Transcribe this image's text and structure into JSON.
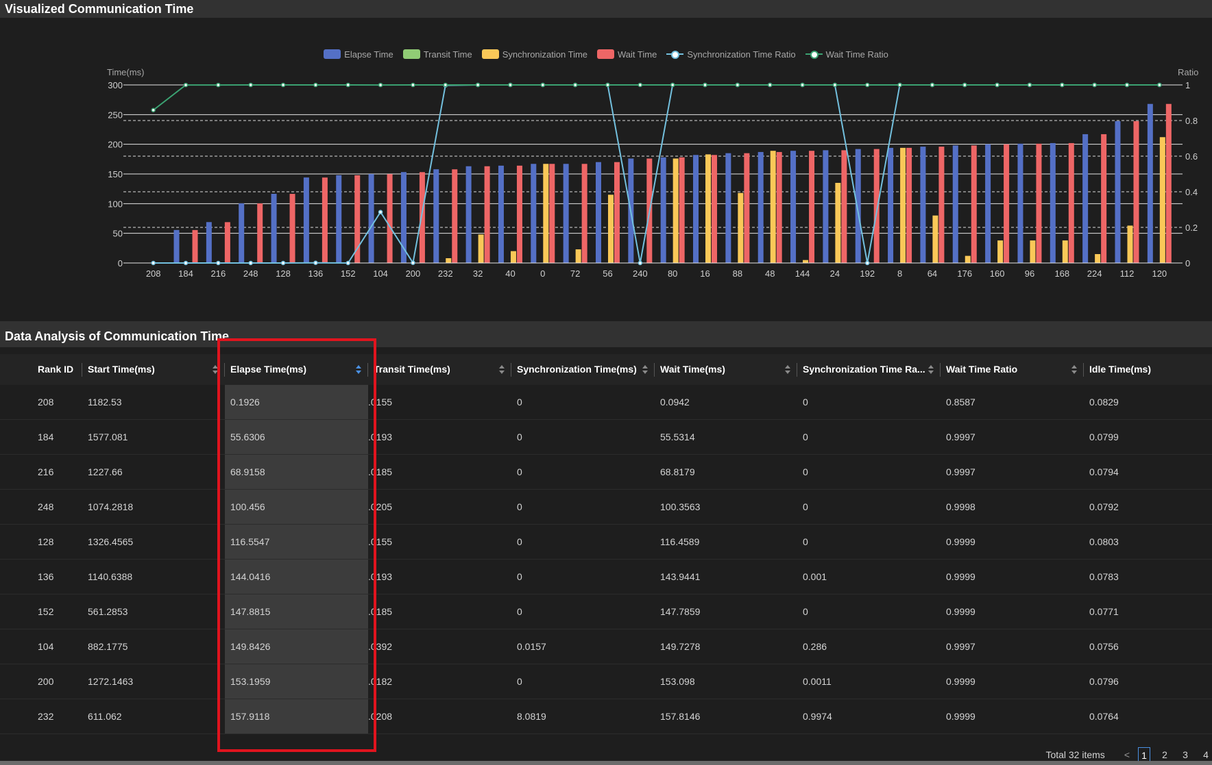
{
  "section1": {
    "title": "Visualized Communication Time"
  },
  "section2": {
    "title": "Data Analysis of Communication Time"
  },
  "legend": [
    {
      "label": "Elapse Time",
      "type": "bar",
      "color": "#5470c6"
    },
    {
      "label": "Transit Time",
      "type": "bar",
      "color": "#91cc75"
    },
    {
      "label": "Synchronization Time",
      "type": "bar",
      "color": "#fac858"
    },
    {
      "label": "Wait Time",
      "type": "bar",
      "color": "#ee6666"
    },
    {
      "label": "Synchronization Time Ratio",
      "type": "line",
      "color": "#73c0de"
    },
    {
      "label": "Wait Time Ratio",
      "type": "line",
      "color": "#3ba272"
    }
  ],
  "chart_data": {
    "type": "bar",
    "ylabel_left": "Time(ms)",
    "ylabel_right": "Ratio",
    "ylim_left": [
      0,
      300
    ],
    "ylim_right": [
      0,
      1
    ],
    "yticks_left": [
      "0",
      "50",
      "100",
      "150",
      "200",
      "250",
      "300"
    ],
    "yticks_right": [
      "0",
      "0.2",
      "0.4",
      "0.6",
      "0.8",
      "1"
    ],
    "categories": [
      "208",
      "184",
      "216",
      "248",
      "128",
      "136",
      "152",
      "104",
      "200",
      "232",
      "32",
      "40",
      "0",
      "72",
      "56",
      "240",
      "80",
      "16",
      "88",
      "48",
      "144",
      "24",
      "192",
      "8",
      "64",
      "176",
      "160",
      "96",
      "168",
      "224",
      "112",
      "120"
    ],
    "series": [
      {
        "name": "Elapse Time",
        "kind": "bar",
        "color": "#5470c6",
        "values": [
          0.1926,
          55.6306,
          68.9158,
          100.456,
          116.5547,
          144.0416,
          147.8815,
          149.8426,
          153.1959,
          157.9118,
          163,
          164,
          167,
          167,
          170,
          176,
          178,
          182,
          185,
          187,
          189,
          190,
          192,
          194,
          196,
          198,
          200,
          201,
          202,
          217,
          239,
          268
        ]
      },
      {
        "name": "Transit Time",
        "kind": "bar",
        "color": "#91cc75",
        "values": [
          0.0155,
          0.0193,
          0.0185,
          0.0205,
          0.0155,
          0.0193,
          0.0185,
          0.0392,
          0.0182,
          0.0208,
          0.02,
          0.02,
          0.02,
          0.02,
          0.02,
          0.02,
          0.02,
          0.02,
          0.02,
          0.02,
          0.02,
          0.02,
          0.02,
          0.02,
          0.02,
          0.02,
          0.02,
          0.02,
          0.02,
          0.02,
          0.02,
          0.02
        ]
      },
      {
        "name": "Synchronization Time",
        "kind": "bar",
        "color": "#fac858",
        "values": [
          0,
          0,
          0,
          0,
          0,
          0,
          0,
          0.0157,
          0,
          8.0819,
          48,
          20,
          167,
          23,
          115,
          0,
          176,
          183,
          118,
          189,
          5,
          135,
          0,
          194,
          80,
          12,
          38,
          38,
          38,
          15,
          63,
          212
        ]
      },
      {
        "name": "Wait Time",
        "kind": "bar",
        "color": "#ee6666",
        "values": [
          0.0942,
          55.5314,
          68.8179,
          100.3563,
          116.4589,
          143.9441,
          147.7859,
          149.7278,
          153.098,
          157.8146,
          163,
          164,
          167,
          167,
          170,
          176,
          178,
          182,
          185,
          187,
          189,
          190,
          192,
          194,
          196,
          198,
          200,
          201,
          202,
          217,
          239,
          268
        ]
      },
      {
        "name": "Synchronization Time Ratio",
        "kind": "line",
        "color": "#73c0de",
        "values": [
          0,
          0,
          0,
          0,
          0,
          0.001,
          0,
          0.286,
          0.0011,
          0.9974,
          1,
          1,
          1,
          1,
          1,
          0,
          1,
          1,
          1,
          1,
          1,
          1,
          0,
          1,
          1,
          1,
          1,
          1,
          1,
          1,
          1,
          1
        ]
      },
      {
        "name": "Wait Time Ratio",
        "kind": "line",
        "color": "#3ba272",
        "values": [
          0.8587,
          0.9997,
          0.9997,
          0.9998,
          0.9999,
          0.9999,
          0.9999,
          0.9997,
          0.9999,
          0.9999,
          1,
          1,
          1,
          1,
          1,
          1,
          1,
          1,
          1,
          1,
          1,
          1,
          1,
          1,
          1,
          1,
          1,
          1,
          1,
          1,
          1,
          1
        ]
      }
    ]
  },
  "table": {
    "columns": [
      "Rank ID",
      "Start Time(ms)",
      "Elapse Time(ms)",
      "Transit Time(ms)",
      "Synchronization Time(ms)",
      "Wait Time(ms)",
      "Synchronization Time Ra...",
      "Wait Time Ratio",
      "Idle Time(ms)"
    ],
    "rows": [
      [
        "208",
        "1182.53",
        "0.1926",
        ".0155",
        "0",
        "0.0942",
        "0",
        "0.8587",
        "0.0829"
      ],
      [
        "184",
        "1577.081",
        "55.6306",
        ".0193",
        "0",
        "55.5314",
        "0",
        "0.9997",
        "0.0799"
      ],
      [
        "216",
        "1227.66",
        "68.9158",
        ".0185",
        "0",
        "68.8179",
        "0",
        "0.9997",
        "0.0794"
      ],
      [
        "248",
        "1074.2818",
        "100.456",
        ".0205",
        "0",
        "100.3563",
        "0",
        "0.9998",
        "0.0792"
      ],
      [
        "128",
        "1326.4565",
        "116.5547",
        ".0155",
        "0",
        "116.4589",
        "0",
        "0.9999",
        "0.0803"
      ],
      [
        "136",
        "1140.6388",
        "144.0416",
        ".0193",
        "0",
        "143.9441",
        "0.001",
        "0.9999",
        "0.0783"
      ],
      [
        "152",
        "561.2853",
        "147.8815",
        ".0185",
        "0",
        "147.7859",
        "0",
        "0.9999",
        "0.0771"
      ],
      [
        "104",
        "882.1775",
        "149.8426",
        ".0392",
        "0.0157",
        "149.7278",
        "0.286",
        "0.9997",
        "0.0756"
      ],
      [
        "200",
        "1272.1463",
        "153.1959",
        ".0182",
        "0",
        "153.098",
        "0.0011",
        "0.9999",
        "0.0796"
      ],
      [
        "232",
        "611.062",
        "157.9118",
        ".0208",
        "8.0819",
        "157.8146",
        "0.9974",
        "0.9999",
        "0.0764"
      ]
    ]
  },
  "pager": {
    "total": "Total 32 items",
    "prev": "<",
    "pages": [
      "1",
      "2",
      "3",
      "4"
    ],
    "current": "1"
  }
}
